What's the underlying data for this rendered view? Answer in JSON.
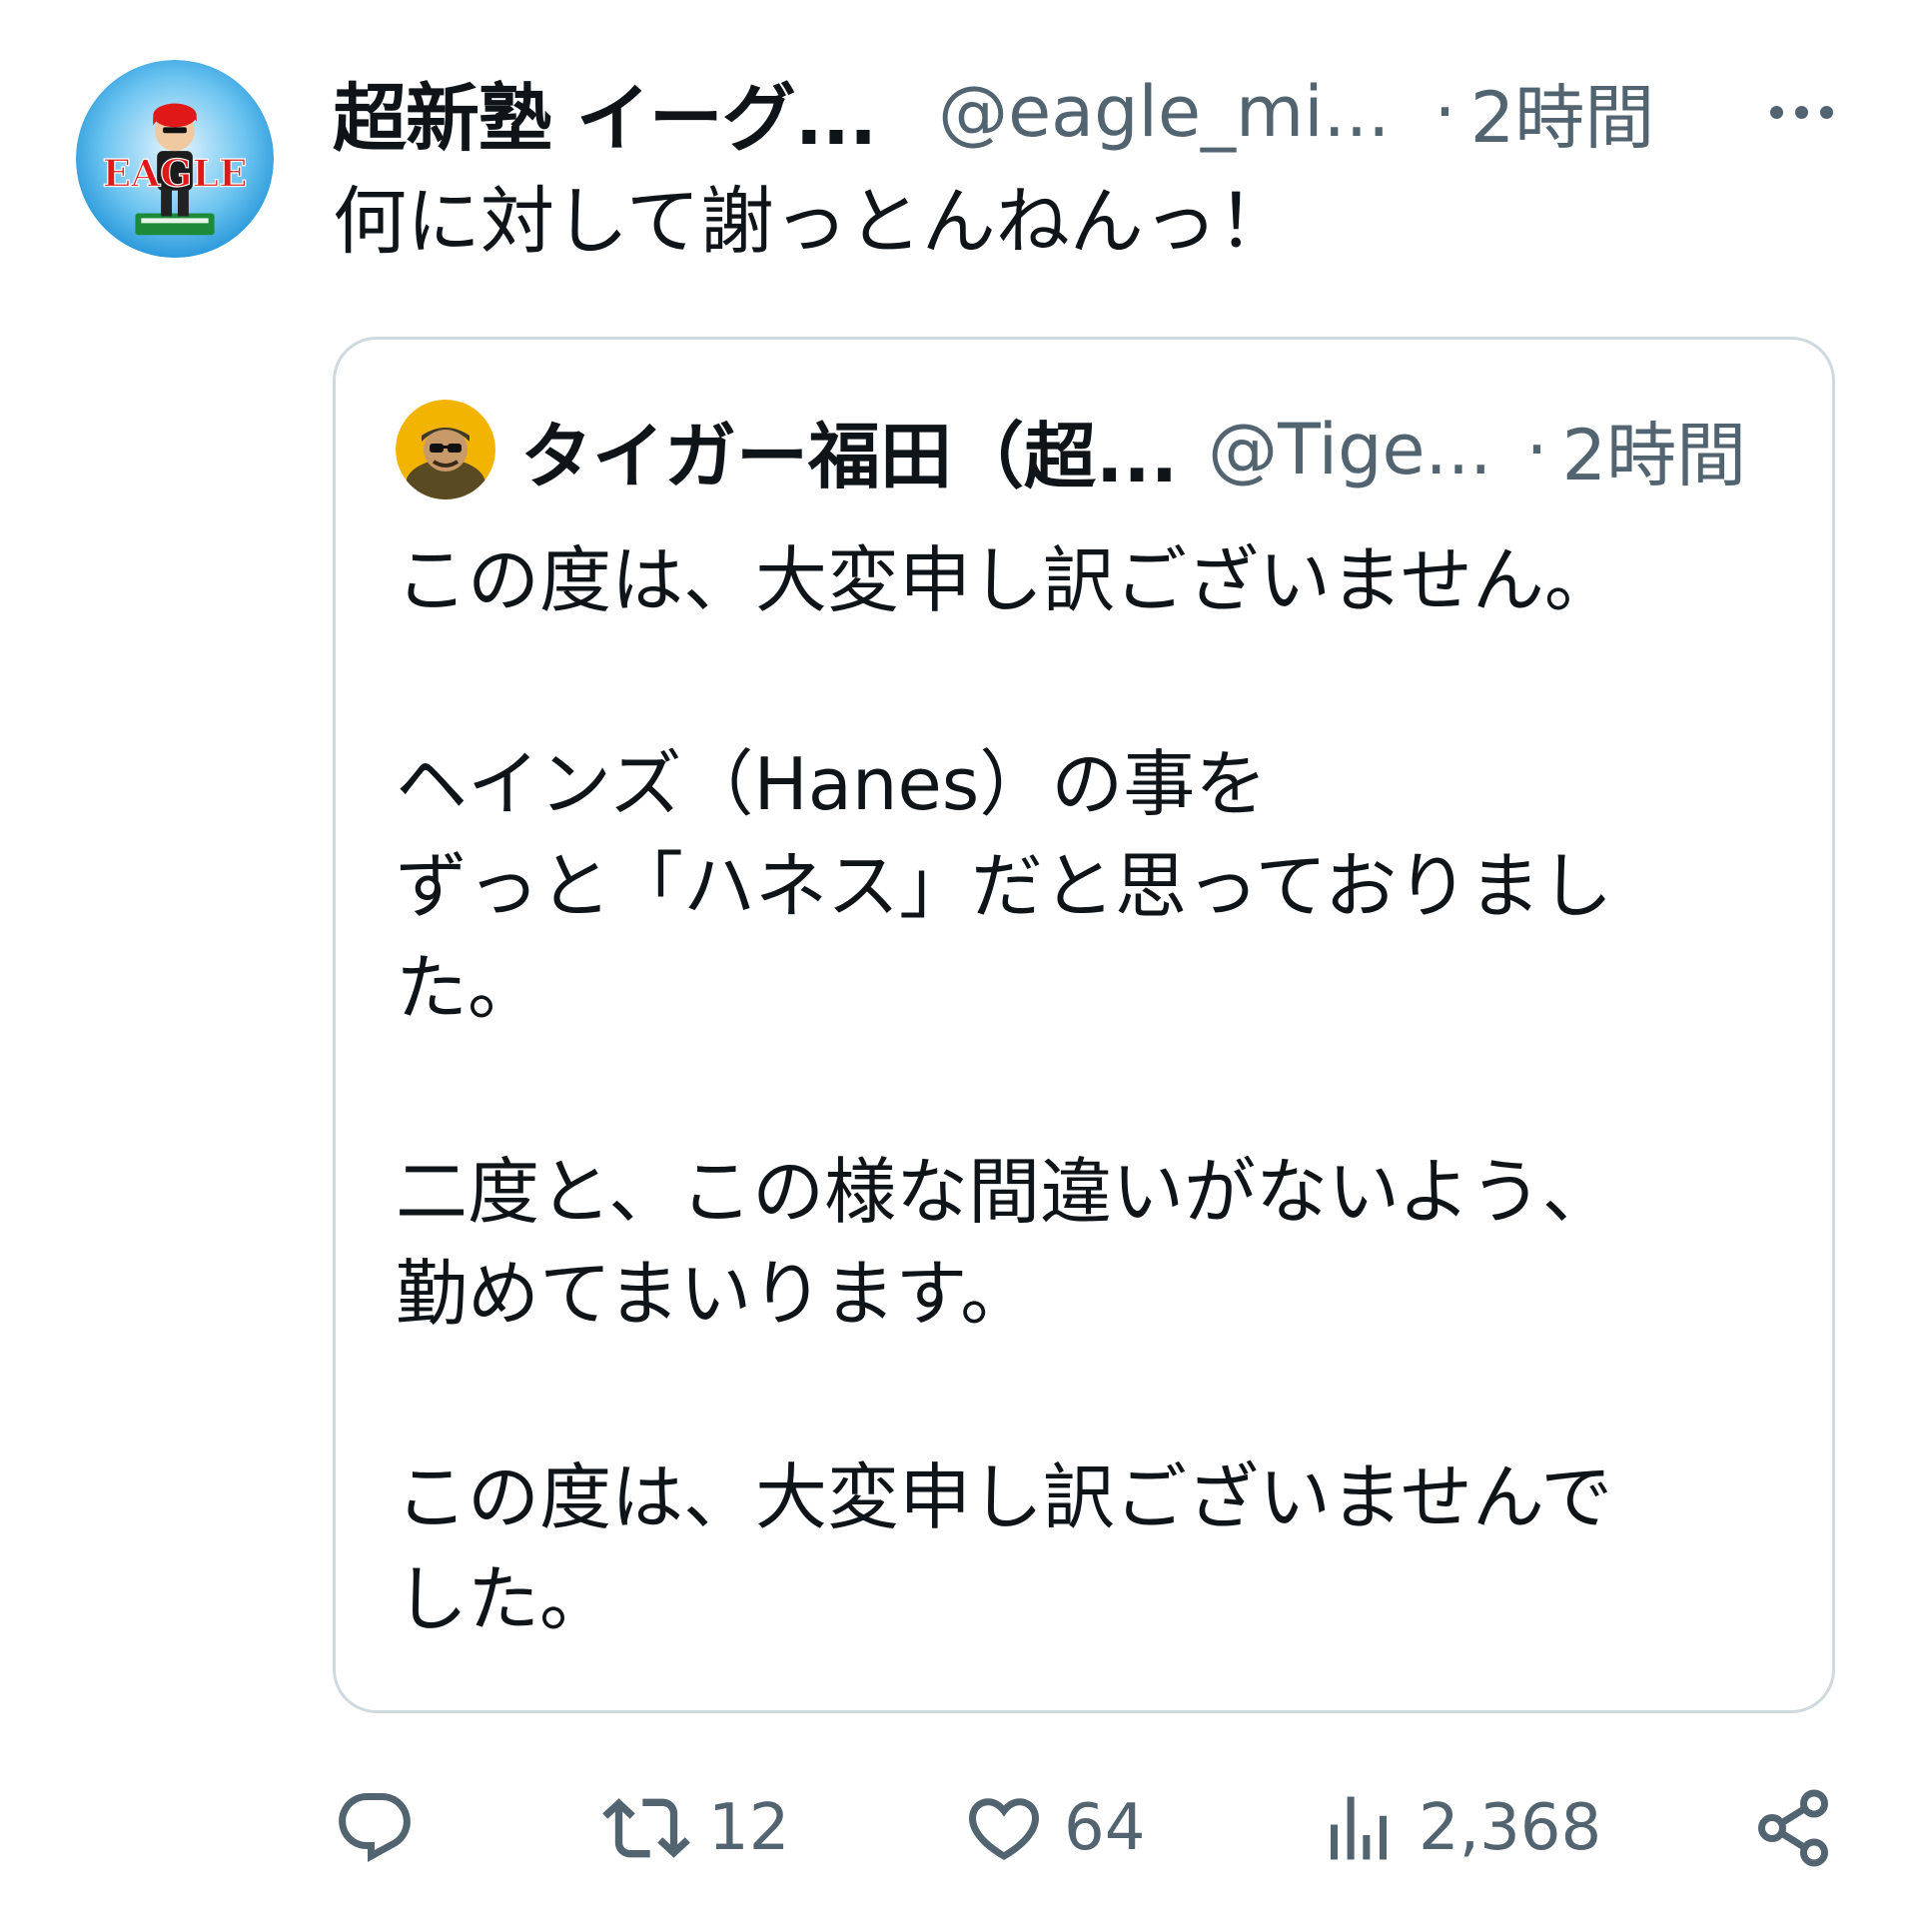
{
  "tweet": {
    "display_name": "超新塾 イーグ...",
    "handle": "@eagle_mi...",
    "separator": "·",
    "time": "2時間",
    "text": "何に対して謝っとんねんっ！",
    "avatar_text": "EAGLE"
  },
  "quote": {
    "display_name": "タイガー福田（超...",
    "handle": "@Tige...",
    "separator": "·",
    "time": "2時間",
    "lines": [
      "この度は、大変申し訳ございません。",
      "",
      "ヘインズ（Hanes）の事を",
      "ずっと「ハネス」だと思っておりまし",
      "た。",
      "",
      "二度と、この様な間違いがないよう、",
      "勤めてまいります。",
      "",
      "この度は、大変申し訳ございませんで",
      "した。"
    ]
  },
  "actions": {
    "reply_count": "",
    "retweet_count": "12",
    "like_count": "64",
    "views_count": "2,368"
  },
  "colors": {
    "text": "#0f1419",
    "secondary": "#536471",
    "border": "#cfd9de"
  }
}
